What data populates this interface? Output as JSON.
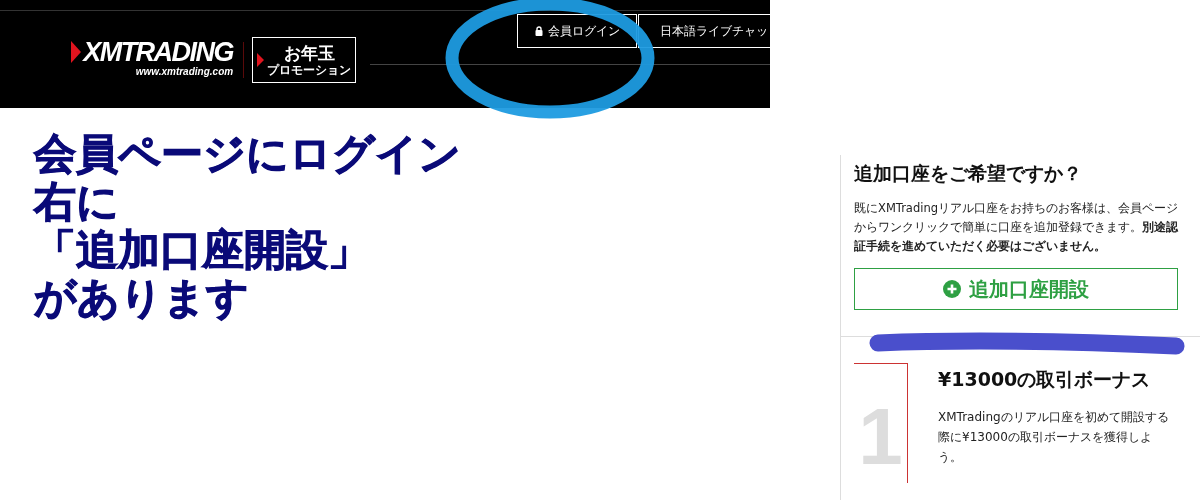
{
  "header": {
    "logo": {
      "wordmark": "XMTRADING",
      "url": "www.xmtrading.com"
    },
    "promo": {
      "title": "お年玉",
      "subtitle": "プロモーション"
    },
    "nav": [
      {
        "label": "会員ログイン",
        "kind": "login"
      },
      {
        "label": "日本語ライブチャッ",
        "kind": "chat"
      }
    ]
  },
  "annotation": {
    "lines": [
      "会員ページにログイン",
      "右に",
      "「追加口座開設」",
      "があります"
    ]
  },
  "sidebar": {
    "title": "追加口座をご希望ですか？",
    "text": "既にXMTradingリアル口座をお持ちのお客様は、会員ページからワンクリックで簡単に口座を追加登録できます。**別途認証手続を進めていただく必要はございません。**",
    "button": "追加口座開設",
    "steps": [
      {
        "number": "1",
        "title": "¥13000の取引ボーナス",
        "text": "XMTradingのリアル口座を初めて開設する際に¥13000の取引ボーナスを獲得しよう。"
      }
    ]
  }
}
